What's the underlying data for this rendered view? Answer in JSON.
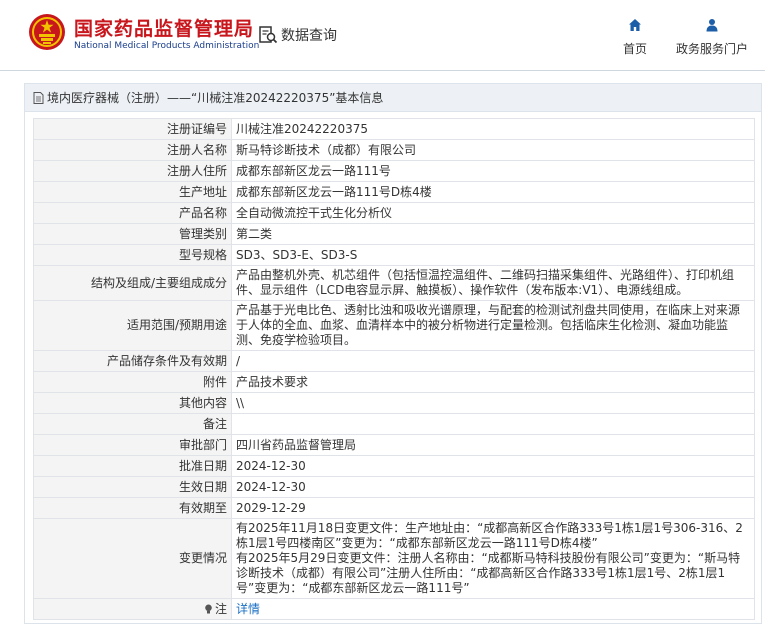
{
  "header": {
    "brand_cn": "国家药品监督管理局",
    "brand_en": "National Medical Products Administration",
    "search_label": "数据查询",
    "nav_home": "首页",
    "nav_portal": "政务服务门户"
  },
  "panel": {
    "title": "境内医疗器械（注册）——“川械注准20242220375”基本信息"
  },
  "rows": [
    {
      "label": "注册证编号",
      "value": "川械注准20242220375"
    },
    {
      "label": "注册人名称",
      "value": "斯马特诊断技术（成都）有限公司"
    },
    {
      "label": "注册人住所",
      "value": "成都东部新区龙云一路111号"
    },
    {
      "label": "生产地址",
      "value": "成都东部新区龙云一路111号D栋4楼"
    },
    {
      "label": "产品名称",
      "value": "全自动微流控干式生化分析仪"
    },
    {
      "label": "管理类别",
      "value": "第二类"
    },
    {
      "label": "型号规格",
      "value": "SD3、SD3-E、SD3-S"
    },
    {
      "label": "结构及组成/主要组成成分",
      "value": "产品由整机外壳、机芯组件（包括恒温控温组件、二维码扫描采集组件、光路组件）、打印机组件、显示组件（LCD电容显示屏、触摸板）、操作软件（发布版本:V1）、电源线组成。"
    },
    {
      "label": "适用范围/预期用途",
      "value": "产品基于光电比色、透射比浊和吸收光谱原理，与配套的检测试剂盘共同使用，在临床上对来源于人体的全血、血浆、血清样本中的被分析物进行定量检测。包括临床生化检测、凝血功能监测、免疫学检验项目。"
    },
    {
      "label": "产品储存条件及有效期",
      "value": "/"
    },
    {
      "label": "附件",
      "value": "产品技术要求"
    },
    {
      "label": "其他内容",
      "value": "\\\\"
    },
    {
      "label": "备注",
      "value": ""
    },
    {
      "label": "审批部门",
      "value": "四川省药品监督管理局"
    },
    {
      "label": "批准日期",
      "value": "2024-12-30"
    },
    {
      "label": "生效日期",
      "value": "2024-12-30"
    },
    {
      "label": "有效期至",
      "value": "2029-12-29"
    },
    {
      "label": "变更情况",
      "value": "有2025年11月18日变更文件：生产地址由：“成都高新区合作路333号1栋1层1号306-316、2栋1层1号四楼南区”变更为：“成都东部新区龙云一路111号D栋4楼” 有2025年5月29日变更文件：注册人名称由：“成都斯马特科技股份有限公司”变更为：“斯马特诊断技术（成都）有限公司”注册人住所由：“成都高新区合作路333号1栋1层1号、2栋1层1号”变更为：“成都东部新区龙云一路111号”"
    },
    {
      "label": "注",
      "value": "详情"
    }
  ],
  "change_lines": [
    "有2025年11月18日变更文件：生产地址由：“成都高新区合作路333号1栋1层1号306-316、2栋1层1号四楼南区”变更为：“成都东部新区龙云一路111号D栋4楼”",
    "有2025年5月29日变更文件：注册人名称由：“成都斯马特科技股份有限公司”变更为：“斯马特诊断技术（成都）有限公司”注册人住所由：“成都高新区合作路333号1栋1层1号、2栋1层1号”变更为：“成都东部新区龙云一路111号”"
  ],
  "colors": {
    "brand_red": "#c8161d",
    "brand_blue": "#1a3e8c",
    "nav_blue": "#1d5ea8",
    "link_blue": "#1a6fc4",
    "label_bg": "#f4f4f4",
    "panel_head_bg": "#edf1f5"
  },
  "icons": {
    "logo": "national-emblem-icon",
    "search": "data-search-icon",
    "home": "home-icon",
    "portal": "user-icon",
    "doc": "document-icon",
    "note": "lightbulb-icon"
  }
}
